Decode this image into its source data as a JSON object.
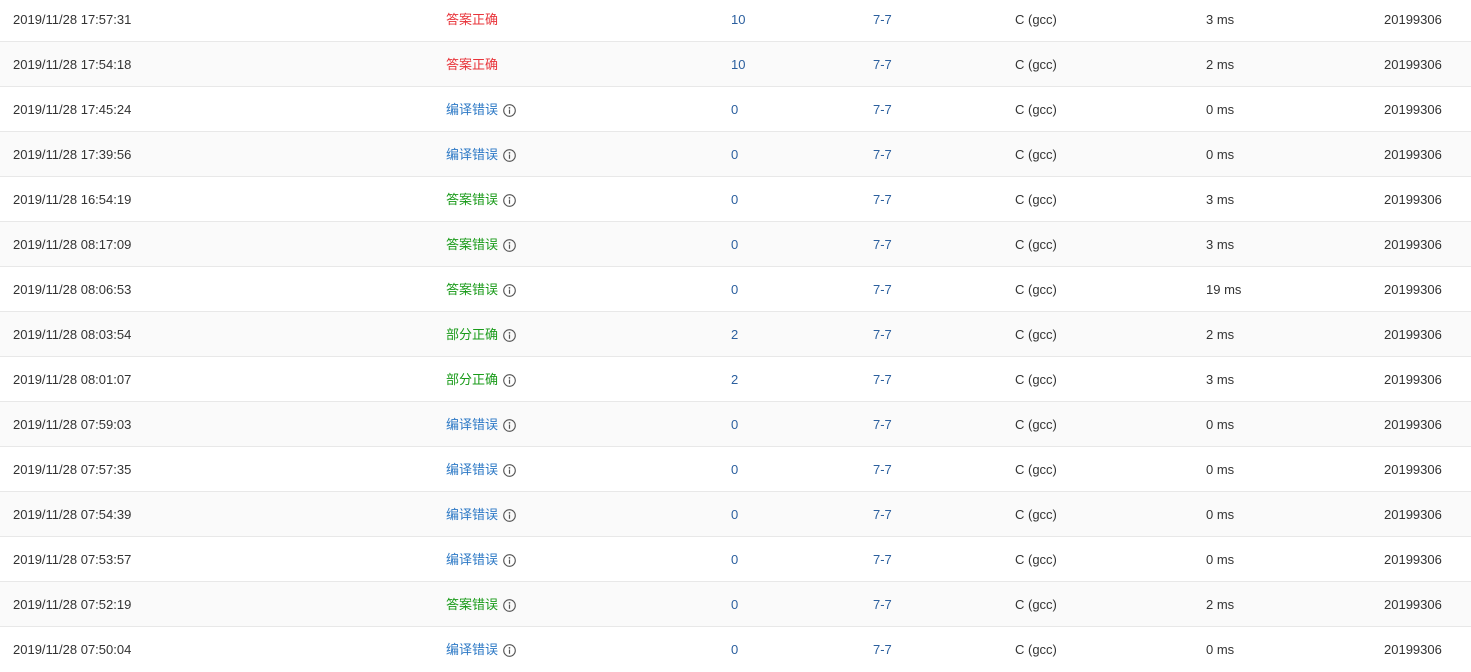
{
  "colors": {
    "accepted": "#e8343a",
    "compile_error": "#2e7ac6",
    "wrong_or_partial": "#1a9b1a",
    "link": "#2b5f9e"
  },
  "rows": [
    {
      "time": "2019/11/28 17:57:31",
      "status": "答案正确",
      "status_type": "accepted",
      "has_info": false,
      "score": "10",
      "problem": "7-7",
      "language": "C (gcc)",
      "time_used": "3 ms",
      "user": "20199306"
    },
    {
      "time": "2019/11/28 17:54:18",
      "status": "答案正确",
      "status_type": "accepted",
      "has_info": false,
      "score": "10",
      "problem": "7-7",
      "language": "C (gcc)",
      "time_used": "2 ms",
      "user": "20199306"
    },
    {
      "time": "2019/11/28 17:45:24",
      "status": "编译错误",
      "status_type": "compile_error",
      "has_info": true,
      "score": "0",
      "problem": "7-7",
      "language": "C (gcc)",
      "time_used": "0 ms",
      "user": "20199306"
    },
    {
      "time": "2019/11/28 17:39:56",
      "status": "编译错误",
      "status_type": "compile_error",
      "has_info": true,
      "score": "0",
      "problem": "7-7",
      "language": "C (gcc)",
      "time_used": "0 ms",
      "user": "20199306"
    },
    {
      "time": "2019/11/28 16:54:19",
      "status": "答案错误",
      "status_type": "wrong_or_partial",
      "has_info": true,
      "score": "0",
      "problem": "7-7",
      "language": "C (gcc)",
      "time_used": "3 ms",
      "user": "20199306"
    },
    {
      "time": "2019/11/28 08:17:09",
      "status": "答案错误",
      "status_type": "wrong_or_partial",
      "has_info": true,
      "score": "0",
      "problem": "7-7",
      "language": "C (gcc)",
      "time_used": "3 ms",
      "user": "20199306"
    },
    {
      "time": "2019/11/28 08:06:53",
      "status": "答案错误",
      "status_type": "wrong_or_partial",
      "has_info": true,
      "score": "0",
      "problem": "7-7",
      "language": "C (gcc)",
      "time_used": "19 ms",
      "user": "20199306"
    },
    {
      "time": "2019/11/28 08:03:54",
      "status": "部分正确",
      "status_type": "wrong_or_partial",
      "has_info": true,
      "score": "2",
      "problem": "7-7",
      "language": "C (gcc)",
      "time_used": "2 ms",
      "user": "20199306"
    },
    {
      "time": "2019/11/28 08:01:07",
      "status": "部分正确",
      "status_type": "wrong_or_partial",
      "has_info": true,
      "score": "2",
      "problem": "7-7",
      "language": "C (gcc)",
      "time_used": "3 ms",
      "user": "20199306"
    },
    {
      "time": "2019/11/28 07:59:03",
      "status": "编译错误",
      "status_type": "compile_error",
      "has_info": true,
      "score": "0",
      "problem": "7-7",
      "language": "C (gcc)",
      "time_used": "0 ms",
      "user": "20199306"
    },
    {
      "time": "2019/11/28 07:57:35",
      "status": "编译错误",
      "status_type": "compile_error",
      "has_info": true,
      "score": "0",
      "problem": "7-7",
      "language": "C (gcc)",
      "time_used": "0 ms",
      "user": "20199306"
    },
    {
      "time": "2019/11/28 07:54:39",
      "status": "编译错误",
      "status_type": "compile_error",
      "has_info": true,
      "score": "0",
      "problem": "7-7",
      "language": "C (gcc)",
      "time_used": "0 ms",
      "user": "20199306"
    },
    {
      "time": "2019/11/28 07:53:57",
      "status": "编译错误",
      "status_type": "compile_error",
      "has_info": true,
      "score": "0",
      "problem": "7-7",
      "language": "C (gcc)",
      "time_used": "0 ms",
      "user": "20199306"
    },
    {
      "time": "2019/11/28 07:52:19",
      "status": "答案错误",
      "status_type": "wrong_or_partial",
      "has_info": true,
      "score": "0",
      "problem": "7-7",
      "language": "C (gcc)",
      "time_used": "2 ms",
      "user": "20199306"
    },
    {
      "time": "2019/11/28 07:50:04",
      "status": "编译错误",
      "status_type": "compile_error",
      "has_info": true,
      "score": "0",
      "problem": "7-7",
      "language": "C (gcc)",
      "time_used": "0 ms",
      "user": "20199306"
    }
  ]
}
